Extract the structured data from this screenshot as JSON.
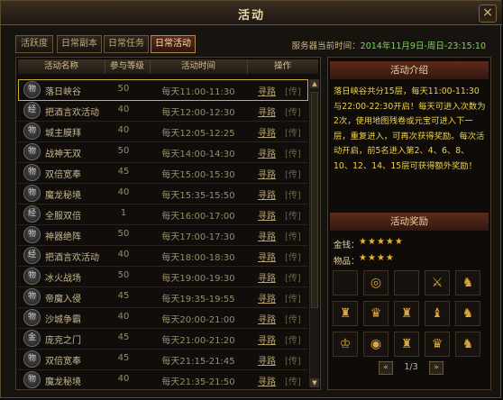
{
  "window": {
    "title": "活动",
    "close_glyph": "×"
  },
  "tabs": [
    {
      "label": "活跃度"
    },
    {
      "label": "日常副本"
    },
    {
      "label": "日常任务"
    },
    {
      "label": "日常活动"
    }
  ],
  "server": {
    "label": "服务器当前时间：",
    "time": "2014年11月9日-周日-23:15:10"
  },
  "table": {
    "headers": [
      "活动名称",
      "参与等级",
      "活动时间",
      "操作"
    ],
    "path_label": "寻路",
    "go_label": "[传]",
    "rows": [
      {
        "icon": "物",
        "name": "落日峡谷",
        "level": "50",
        "time": "每天11:00-11:30"
      },
      {
        "icon": "经",
        "name": "把酒言欢活动",
        "level": "40",
        "time": "每天12:00-12:30"
      },
      {
        "icon": "物",
        "name": "城主膜拜",
        "level": "40",
        "time": "每天12:05-12:25"
      },
      {
        "icon": "物",
        "name": "战神无双",
        "level": "50",
        "time": "每天14:00-14:30"
      },
      {
        "icon": "物",
        "name": "双倍宽奉",
        "level": "45",
        "time": "每天15:00-15:30"
      },
      {
        "icon": "物",
        "name": "魔龙秘境",
        "level": "40",
        "time": "每天15:35-15:50"
      },
      {
        "icon": "经",
        "name": "全服双倍",
        "level": "1",
        "time": "每天16:00-17:00"
      },
      {
        "icon": "物",
        "name": "神器绝阵",
        "level": "50",
        "time": "每天17:00-17:30"
      },
      {
        "icon": "经",
        "name": "把酒言欢活动",
        "level": "40",
        "time": "每天18:00-18:30"
      },
      {
        "icon": "物",
        "name": "冰火战场",
        "level": "50",
        "time": "每天19:00-19:30"
      },
      {
        "icon": "物",
        "name": "帝魔入侵",
        "level": "45",
        "time": "每天19:35-19:55"
      },
      {
        "icon": "物",
        "name": "沙城争霸",
        "level": "40",
        "time": "每天20:00-21:00"
      },
      {
        "icon": "金",
        "name": "庞克之门",
        "level": "45",
        "time": "每天21:00-21:20"
      },
      {
        "icon": "物",
        "name": "双倍宽奉",
        "level": "45",
        "time": "每天21:15-21:45"
      },
      {
        "icon": "物",
        "name": "魔龙秘境",
        "level": "40",
        "time": "每天21:35-21:50"
      }
    ]
  },
  "intro": {
    "header": "活动介绍",
    "text": "落日峡谷共分15层，每天11:00-11:30与22:00-22:30开启！每天可进入次数为2次，使用地图残卷或元宝可进入下一层，重复进入，可再次获得奖励。每次活动开启，前5名进入第2、4、6、8、10、12、14、15层可获得额外奖励！"
  },
  "rewards": {
    "header": "活动奖励",
    "gold_label": "金钱：",
    "gold_stars": 5,
    "items_label": "物品：",
    "items_stars": 4,
    "star_color": "#f2b41e",
    "grid": [
      {
        "icon": ""
      },
      {
        "icon": "medal-icon",
        "glyph": "◎"
      },
      {
        "icon": ""
      },
      {
        "icon": "sword-icon",
        "glyph": "⚔"
      },
      {
        "icon": "armor-icon",
        "glyph": "♞"
      },
      {
        "icon": "armor-icon",
        "glyph": "♜"
      },
      {
        "icon": "helmet-icon",
        "glyph": "♛"
      },
      {
        "icon": "armor-icon",
        "glyph": "♜"
      },
      {
        "icon": "bracer-icon",
        "glyph": "♝"
      },
      {
        "icon": "boots-icon",
        "glyph": "♞"
      },
      {
        "icon": "ring-icon",
        "glyph": "♔"
      },
      {
        "icon": "ring-icon",
        "glyph": "◉"
      },
      {
        "icon": "armor-icon",
        "glyph": "♜"
      },
      {
        "icon": "helmet-icon",
        "glyph": "♛"
      },
      {
        "icon": "boots-icon",
        "glyph": "♞"
      }
    ],
    "page": "1/3",
    "prev_glyph": "«",
    "next_glyph": "»"
  }
}
